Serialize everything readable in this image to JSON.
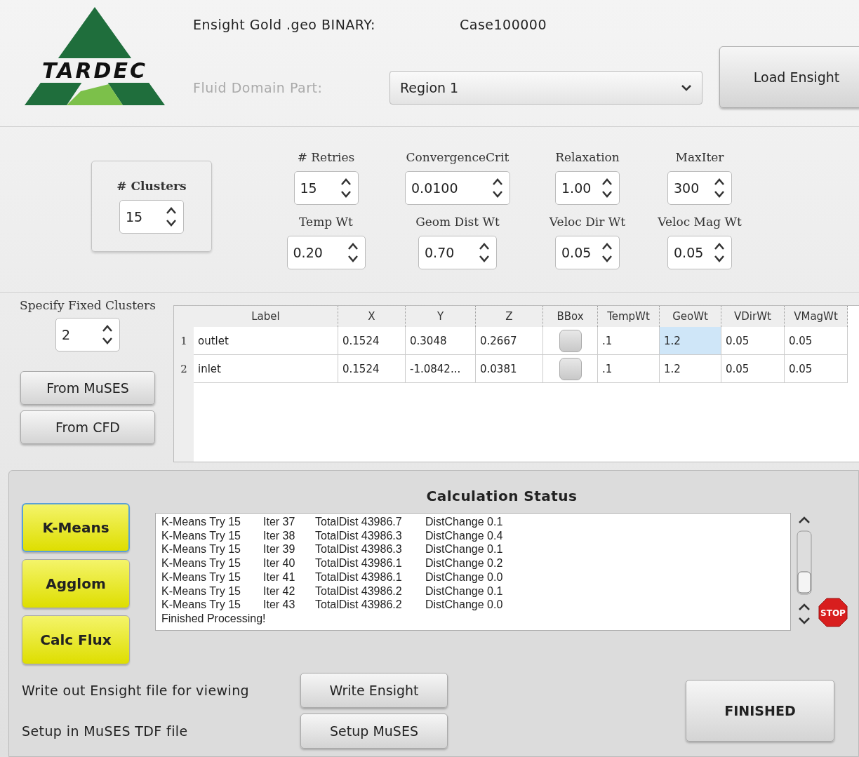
{
  "logo": {
    "text": "TARDEC"
  },
  "source": {
    "label": "Ensight Gold .geo BINARY:",
    "value": "Case100000"
  },
  "fluid_domain": {
    "label": "Fluid Domain Part:",
    "disabled": true,
    "value": "Region 1"
  },
  "load_button": "Load Ensight",
  "clusters": {
    "label": "# Clusters",
    "value": "15"
  },
  "params": [
    {
      "label": "# Retries",
      "value": "15"
    },
    {
      "label": "ConvergenceCrit",
      "value": "0.0100"
    },
    {
      "label": "Relaxation",
      "value": "1.00"
    },
    {
      "label": "MaxIter",
      "value": "300"
    },
    {
      "label": "Temp Wt",
      "value": "0.20"
    },
    {
      "label": "Geom Dist Wt",
      "value": "0.70"
    },
    {
      "label": "Veloc Dir Wt",
      "value": "0.05"
    },
    {
      "label": "Veloc Mag Wt",
      "value": "0.05"
    }
  ],
  "fixed_clusters": {
    "label": "Specify Fixed Clusters",
    "value": "2"
  },
  "fixed_buttons": [
    "From MuSES",
    "From CFD"
  ],
  "table": {
    "columns": [
      "Label",
      "X",
      "Y",
      "Z",
      "BBox",
      "TempWt",
      "GeoWt",
      "VDirWt",
      "VMagWt"
    ],
    "rows": [
      {
        "index": "1",
        "cells": [
          {
            "kind": "text",
            "text": "outlet",
            "selected": false
          },
          {
            "kind": "text",
            "text": "0.1524",
            "selected": false
          },
          {
            "kind": "text",
            "text": "0.3048",
            "selected": false
          },
          {
            "kind": "text",
            "text": "0.2667",
            "selected": false
          },
          {
            "kind": "check",
            "checked": false,
            "selected": false
          },
          {
            "kind": "text",
            "text": ".1",
            "selected": false
          },
          {
            "kind": "text",
            "text": "1.2",
            "selected": true
          },
          {
            "kind": "text",
            "text": "0.05",
            "selected": false
          },
          {
            "kind": "text",
            "text": "0.05",
            "selected": false
          }
        ]
      },
      {
        "index": "2",
        "cells": [
          {
            "kind": "text",
            "text": "inlet",
            "selected": false
          },
          {
            "kind": "text",
            "text": "0.1524",
            "selected": false
          },
          {
            "kind": "text",
            "text": "-1.0842...",
            "selected": false
          },
          {
            "kind": "text",
            "text": "0.0381",
            "selected": false
          },
          {
            "kind": "check",
            "checked": false,
            "selected": false
          },
          {
            "kind": "text",
            "text": ".1",
            "selected": false
          },
          {
            "kind": "text",
            "text": "1.2",
            "selected": false
          },
          {
            "kind": "text",
            "text": "0.05",
            "selected": false
          },
          {
            "kind": "text",
            "text": "0.05",
            "selected": false
          }
        ]
      }
    ]
  },
  "methods": [
    {
      "label": "K-Means",
      "focused": true
    },
    {
      "label": "Agglom",
      "focused": false
    },
    {
      "label": "Calc Flux",
      "focused": false
    }
  ],
  "status": {
    "title": "Calculation Status",
    "lines": [
      [
        "K-Means Try 15",
        "Iter 37",
        "TotalDist 43986.7",
        "DistChange 0.1"
      ],
      [
        "K-Means Try 15",
        "Iter 38",
        "TotalDist 43986.3",
        "DistChange 0.4"
      ],
      [
        "K-Means Try 15",
        "Iter 39",
        "TotalDist 43986.3",
        "DistChange 0.1"
      ],
      [
        "K-Means Try 15",
        "Iter 40",
        "TotalDist 43986.1",
        "DistChange 0.2"
      ],
      [
        "K-Means Try 15",
        "Iter 41",
        "TotalDist 43986.1",
        "DistChange 0.0"
      ],
      [
        "K-Means Try 15",
        "Iter 42",
        "TotalDist 43986.2",
        "DistChange 0.1"
      ],
      [
        "K-Means Try 15",
        "Iter 43",
        "TotalDist 43986.2",
        "DistChange 0.0"
      ],
      [
        "Finished Processing!"
      ]
    ],
    "stop_label": "STOP"
  },
  "outputs": [
    {
      "label": "Write out Ensight file for viewing",
      "button": "Write Ensight"
    },
    {
      "label": "Setup in MuSES TDF file",
      "button": "Setup MuSES"
    }
  ],
  "finished_button": "FINISHED"
}
